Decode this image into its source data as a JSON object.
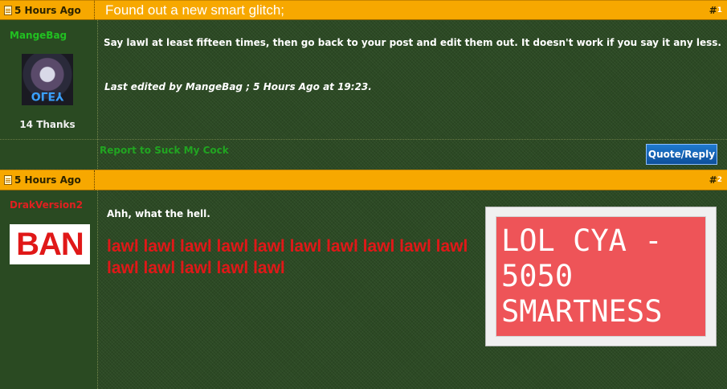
{
  "posts": [
    {
      "date": "5 Hours Ago",
      "title": "Found out a new smart glitch;",
      "number_hash": "#",
      "number": "1",
      "username": "MangeBag",
      "avatar_text": "OLEY",
      "thanks": "14 Thanks",
      "message": "Say lawl at least fifteen times, then go back to your post and edit them out. It doesn't work if you say it any less.",
      "edited": "Last edited by MangeBag ; 5 Hours Ago at 19:23.",
      "report_link": "Report to Suck My Cock",
      "quote_button": "Quote/Reply"
    },
    {
      "date": "5 Hours Ago",
      "number_hash": "#",
      "number": "2",
      "username": "DrakVersion2",
      "ban_label": "BAN",
      "message": "Ahh, what the hell.",
      "lawl_text": "lawl lawl lawl lawl lawl lawl lawl lawl lawl lawl lawl lawl lawl lawl lawl",
      "image_text": "LOL CYA - 5050 SMARTNESS"
    }
  ],
  "colors": {
    "header_bar": "#f7a800",
    "background": "#2c4a24",
    "username_green": "#21c021",
    "username_red": "#e02020",
    "button_blue": "#1f7ad0",
    "image_red": "#ee5458"
  },
  "icons": [
    "document-icon"
  ]
}
